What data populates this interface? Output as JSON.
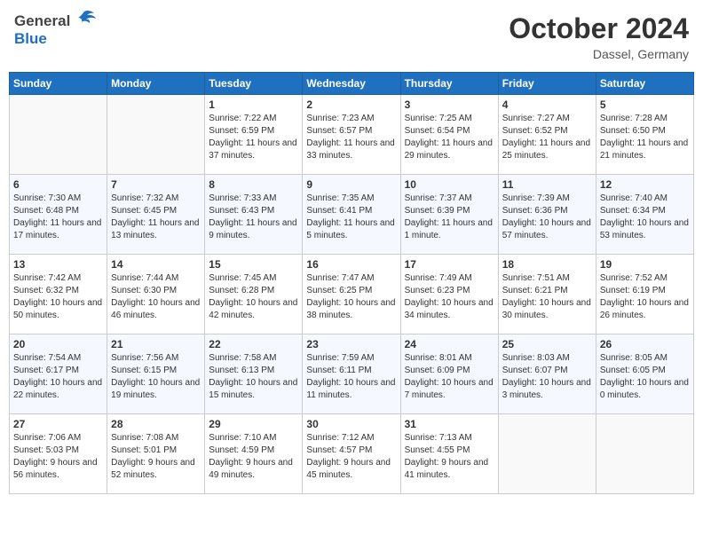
{
  "header": {
    "logo_line1": "General",
    "logo_line2": "Blue",
    "month": "October 2024",
    "location": "Dassel, Germany"
  },
  "weekdays": [
    "Sunday",
    "Monday",
    "Tuesday",
    "Wednesday",
    "Thursday",
    "Friday",
    "Saturday"
  ],
  "weeks": [
    [
      {
        "day": "",
        "info": ""
      },
      {
        "day": "",
        "info": ""
      },
      {
        "day": "1",
        "info": "Sunrise: 7:22 AM\nSunset: 6:59 PM\nDaylight: 11 hours and 37 minutes."
      },
      {
        "day": "2",
        "info": "Sunrise: 7:23 AM\nSunset: 6:57 PM\nDaylight: 11 hours and 33 minutes."
      },
      {
        "day": "3",
        "info": "Sunrise: 7:25 AM\nSunset: 6:54 PM\nDaylight: 11 hours and 29 minutes."
      },
      {
        "day": "4",
        "info": "Sunrise: 7:27 AM\nSunset: 6:52 PM\nDaylight: 11 hours and 25 minutes."
      },
      {
        "day": "5",
        "info": "Sunrise: 7:28 AM\nSunset: 6:50 PM\nDaylight: 11 hours and 21 minutes."
      }
    ],
    [
      {
        "day": "6",
        "info": "Sunrise: 7:30 AM\nSunset: 6:48 PM\nDaylight: 11 hours and 17 minutes."
      },
      {
        "day": "7",
        "info": "Sunrise: 7:32 AM\nSunset: 6:45 PM\nDaylight: 11 hours and 13 minutes."
      },
      {
        "day": "8",
        "info": "Sunrise: 7:33 AM\nSunset: 6:43 PM\nDaylight: 11 hours and 9 minutes."
      },
      {
        "day": "9",
        "info": "Sunrise: 7:35 AM\nSunset: 6:41 PM\nDaylight: 11 hours and 5 minutes."
      },
      {
        "day": "10",
        "info": "Sunrise: 7:37 AM\nSunset: 6:39 PM\nDaylight: 11 hours and 1 minute."
      },
      {
        "day": "11",
        "info": "Sunrise: 7:39 AM\nSunset: 6:36 PM\nDaylight: 10 hours and 57 minutes."
      },
      {
        "day": "12",
        "info": "Sunrise: 7:40 AM\nSunset: 6:34 PM\nDaylight: 10 hours and 53 minutes."
      }
    ],
    [
      {
        "day": "13",
        "info": "Sunrise: 7:42 AM\nSunset: 6:32 PM\nDaylight: 10 hours and 50 minutes."
      },
      {
        "day": "14",
        "info": "Sunrise: 7:44 AM\nSunset: 6:30 PM\nDaylight: 10 hours and 46 minutes."
      },
      {
        "day": "15",
        "info": "Sunrise: 7:45 AM\nSunset: 6:28 PM\nDaylight: 10 hours and 42 minutes."
      },
      {
        "day": "16",
        "info": "Sunrise: 7:47 AM\nSunset: 6:25 PM\nDaylight: 10 hours and 38 minutes."
      },
      {
        "day": "17",
        "info": "Sunrise: 7:49 AM\nSunset: 6:23 PM\nDaylight: 10 hours and 34 minutes."
      },
      {
        "day": "18",
        "info": "Sunrise: 7:51 AM\nSunset: 6:21 PM\nDaylight: 10 hours and 30 minutes."
      },
      {
        "day": "19",
        "info": "Sunrise: 7:52 AM\nSunset: 6:19 PM\nDaylight: 10 hours and 26 minutes."
      }
    ],
    [
      {
        "day": "20",
        "info": "Sunrise: 7:54 AM\nSunset: 6:17 PM\nDaylight: 10 hours and 22 minutes."
      },
      {
        "day": "21",
        "info": "Sunrise: 7:56 AM\nSunset: 6:15 PM\nDaylight: 10 hours and 19 minutes."
      },
      {
        "day": "22",
        "info": "Sunrise: 7:58 AM\nSunset: 6:13 PM\nDaylight: 10 hours and 15 minutes."
      },
      {
        "day": "23",
        "info": "Sunrise: 7:59 AM\nSunset: 6:11 PM\nDaylight: 10 hours and 11 minutes."
      },
      {
        "day": "24",
        "info": "Sunrise: 8:01 AM\nSunset: 6:09 PM\nDaylight: 10 hours and 7 minutes."
      },
      {
        "day": "25",
        "info": "Sunrise: 8:03 AM\nSunset: 6:07 PM\nDaylight: 10 hours and 3 minutes."
      },
      {
        "day": "26",
        "info": "Sunrise: 8:05 AM\nSunset: 6:05 PM\nDaylight: 10 hours and 0 minutes."
      }
    ],
    [
      {
        "day": "27",
        "info": "Sunrise: 7:06 AM\nSunset: 5:03 PM\nDaylight: 9 hours and 56 minutes."
      },
      {
        "day": "28",
        "info": "Sunrise: 7:08 AM\nSunset: 5:01 PM\nDaylight: 9 hours and 52 minutes."
      },
      {
        "day": "29",
        "info": "Sunrise: 7:10 AM\nSunset: 4:59 PM\nDaylight: 9 hours and 49 minutes."
      },
      {
        "day": "30",
        "info": "Sunrise: 7:12 AM\nSunset: 4:57 PM\nDaylight: 9 hours and 45 minutes."
      },
      {
        "day": "31",
        "info": "Sunrise: 7:13 AM\nSunset: 4:55 PM\nDaylight: 9 hours and 41 minutes."
      },
      {
        "day": "",
        "info": ""
      },
      {
        "day": "",
        "info": ""
      }
    ]
  ]
}
